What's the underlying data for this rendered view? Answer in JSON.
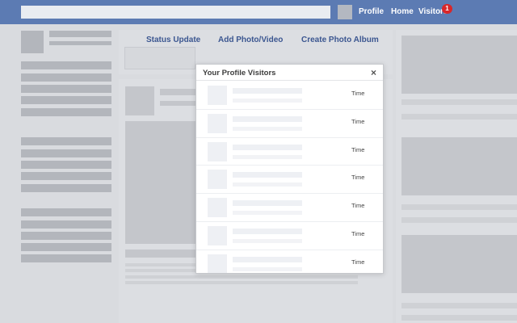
{
  "topbar": {
    "nav": {
      "profile": "Profile",
      "home": "Home",
      "visitors": "Visitors"
    },
    "visitors_badge": "1"
  },
  "composer": {
    "actions": [
      "Status Update",
      "Add Photo/Video",
      "Create Photo Album"
    ]
  },
  "modal": {
    "title": "Your Profile Visitors",
    "close_label": "×",
    "rows": [
      {
        "time": "Time"
      },
      {
        "time": "Time"
      },
      {
        "time": "Time"
      },
      {
        "time": "Time"
      },
      {
        "time": "Time"
      },
      {
        "time": "Time"
      },
      {
        "time": "Time"
      }
    ]
  },
  "colors": {
    "topbar": "#5c7bb3",
    "link": "#3b5690",
    "badge": "#d8272a",
    "background": "#d9dbdf"
  }
}
